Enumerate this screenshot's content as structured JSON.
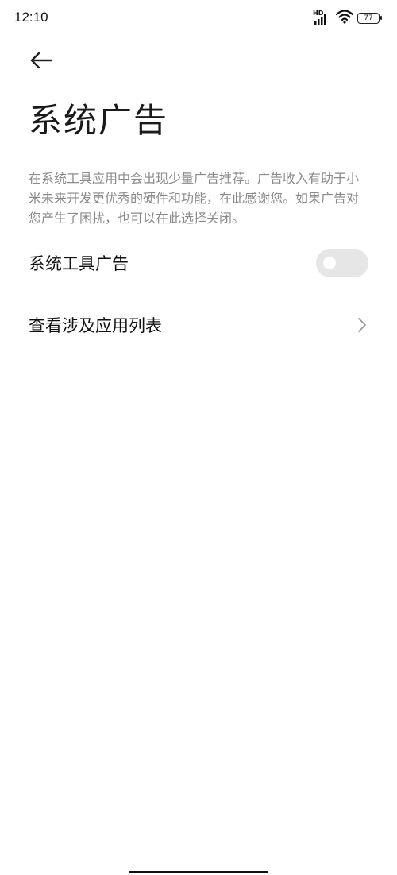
{
  "status_bar": {
    "time": "12:10",
    "network_label": "HD",
    "battery_level": "77"
  },
  "header": {
    "back_icon": "arrow-left-icon",
    "title": "系统广告"
  },
  "description": "在系统工具应用中会出现少量广告推荐。广告收入有助于小米未来开发更优秀的硬件和功能，在此感谢您。如果广告对您产生了困扰，也可以在此选择关闭。",
  "settings": {
    "system_tool_ads": {
      "label": "系统工具广告",
      "enabled": false
    },
    "view_apps": {
      "label": "查看涉及应用列表",
      "icon": "chevron-right-icon"
    }
  },
  "colors": {
    "background": "#ffffff",
    "description_text": "#8a8a8a",
    "toggle_off": "#e6e6e6"
  }
}
